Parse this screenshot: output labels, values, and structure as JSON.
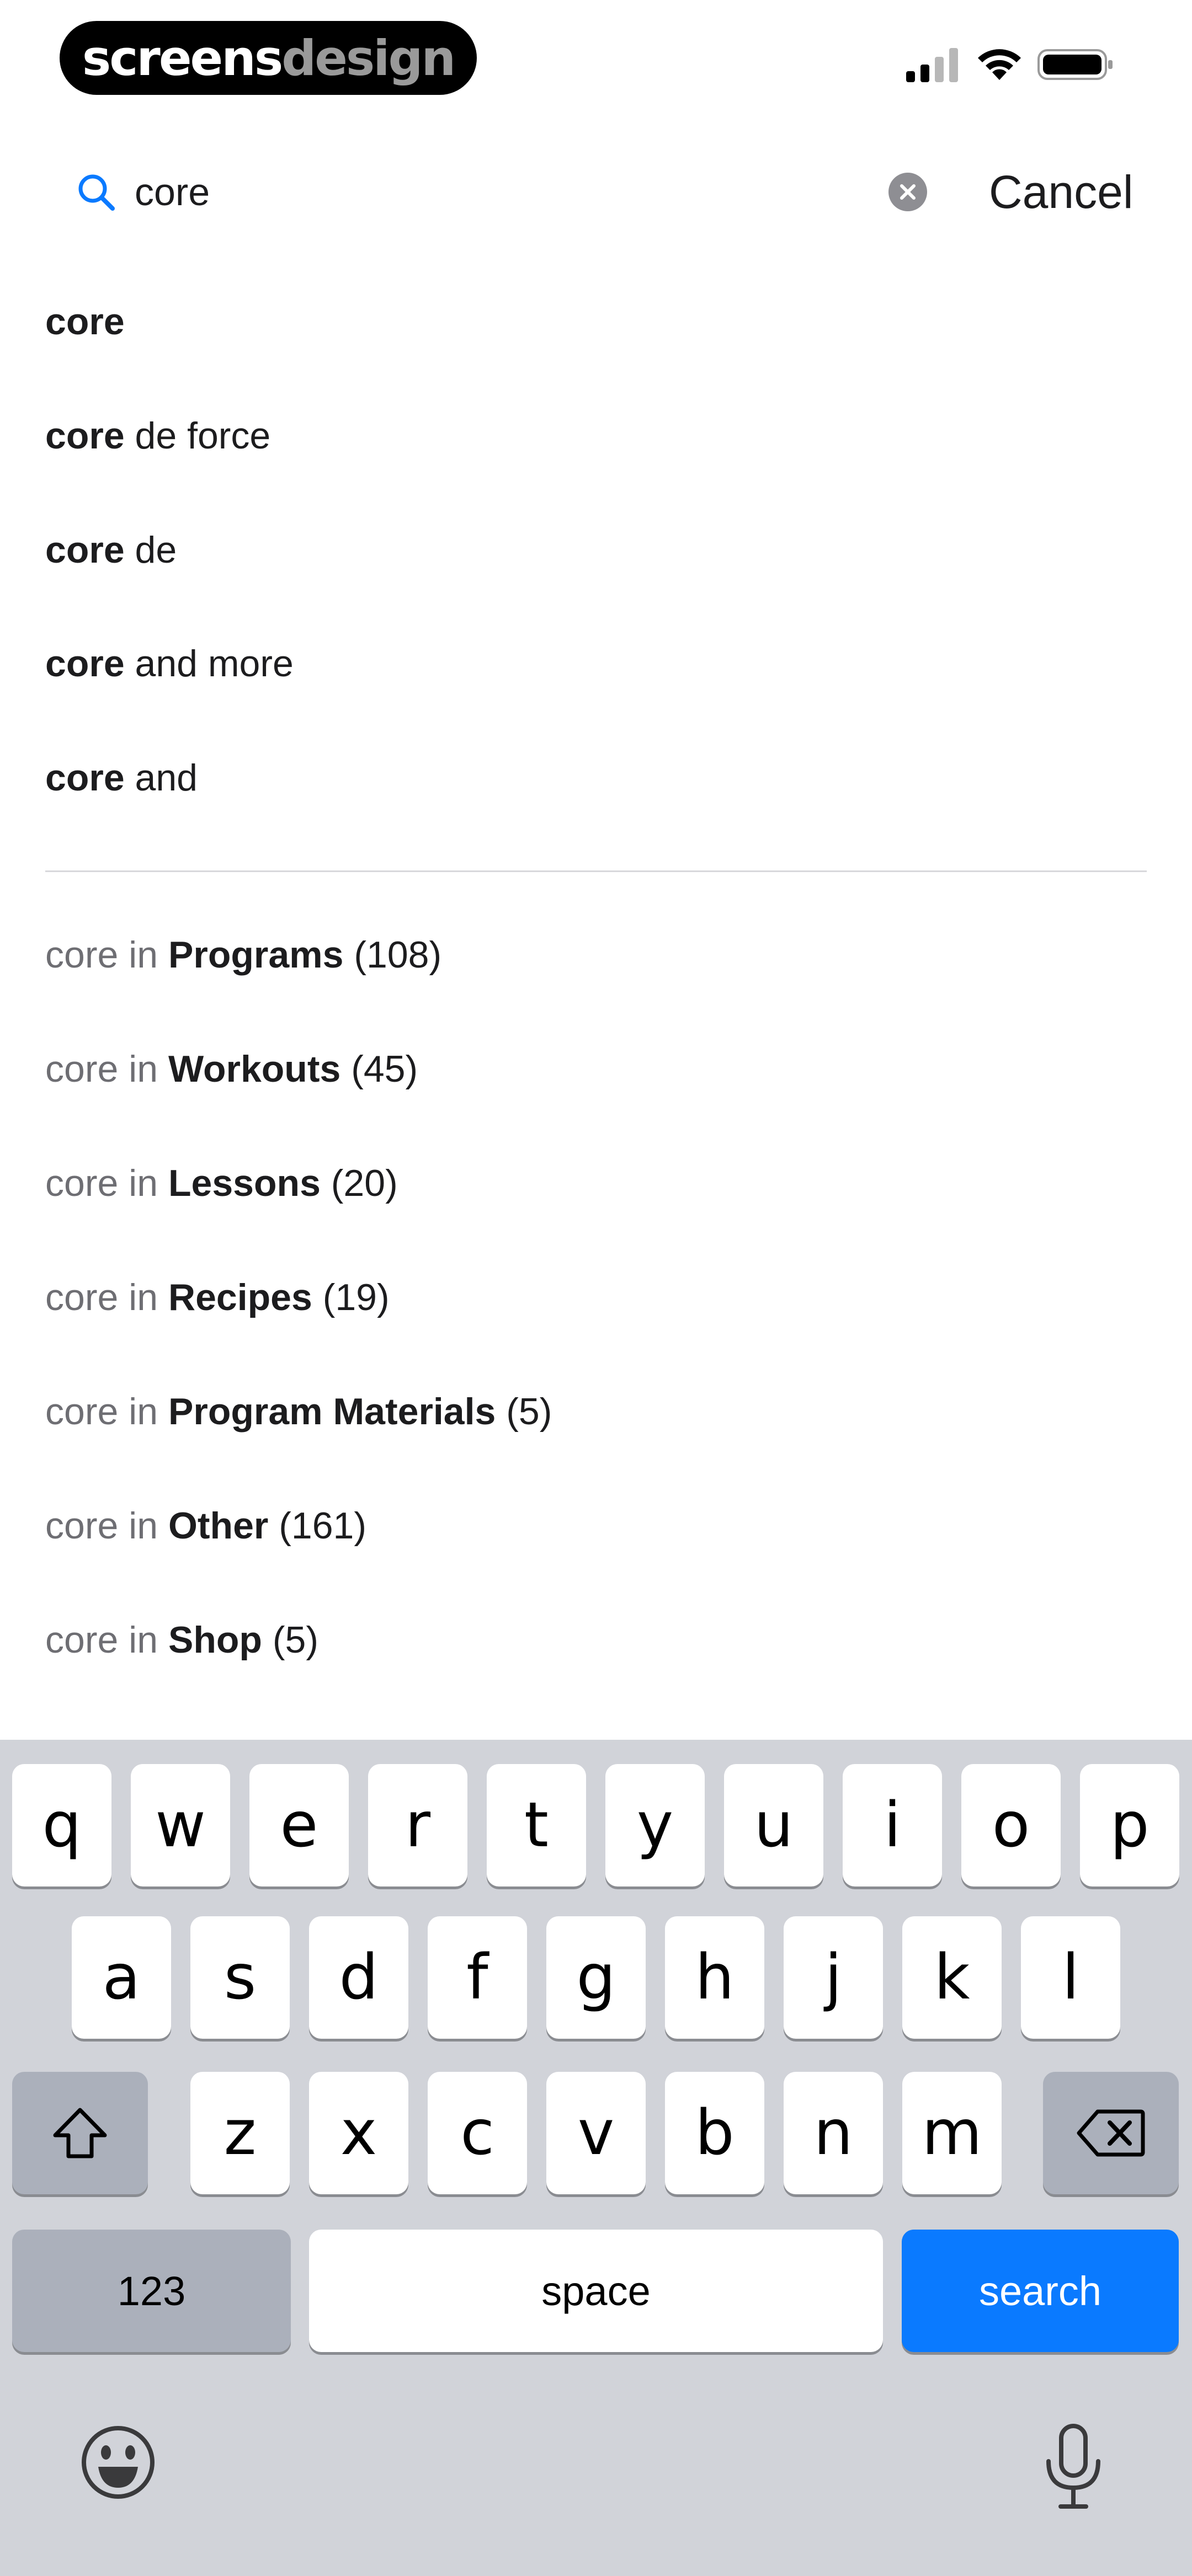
{
  "status_bar": {
    "logo_part1": "screens",
    "logo_part2": "design"
  },
  "search": {
    "value": "core",
    "cancel_label": "Cancel"
  },
  "suggestions": [
    {
      "bold": "core",
      "rest": ""
    },
    {
      "bold": "core",
      "rest": " de force"
    },
    {
      "bold": "core",
      "rest": " de"
    },
    {
      "bold": "core",
      "rest": " and more"
    },
    {
      "bold": "core",
      "rest": " and"
    }
  ],
  "scopes": [
    {
      "prefix": "core in ",
      "name": "Programs",
      "count": " (108)"
    },
    {
      "prefix": "core in ",
      "name": "Workouts",
      "count": " (45)"
    },
    {
      "prefix": "core in ",
      "name": "Lessons",
      "count": " (20)"
    },
    {
      "prefix": "core in ",
      "name": "Recipes",
      "count": " (19)"
    },
    {
      "prefix": "core in ",
      "name": "Program Materials",
      "count": " (5)"
    },
    {
      "prefix": "core in ",
      "name": "Other",
      "count": " (161)"
    },
    {
      "prefix": "core in ",
      "name": "Shop",
      "count": " (5)"
    }
  ],
  "keyboard": {
    "row1": [
      "q",
      "w",
      "e",
      "r",
      "t",
      "y",
      "u",
      "i",
      "o",
      "p"
    ],
    "row2": [
      "a",
      "s",
      "d",
      "f",
      "g",
      "h",
      "j",
      "k",
      "l"
    ],
    "row3": [
      "z",
      "x",
      "c",
      "v",
      "b",
      "n",
      "m"
    ],
    "numbers_label": "123",
    "space_label": "space",
    "search_label": "search",
    "shift_icon": "shift-icon",
    "delete_icon": "backspace-icon",
    "emoji_icon": "emoji-icon",
    "mic_icon": "microphone-icon",
    "accent_color": "#0a7aff"
  }
}
